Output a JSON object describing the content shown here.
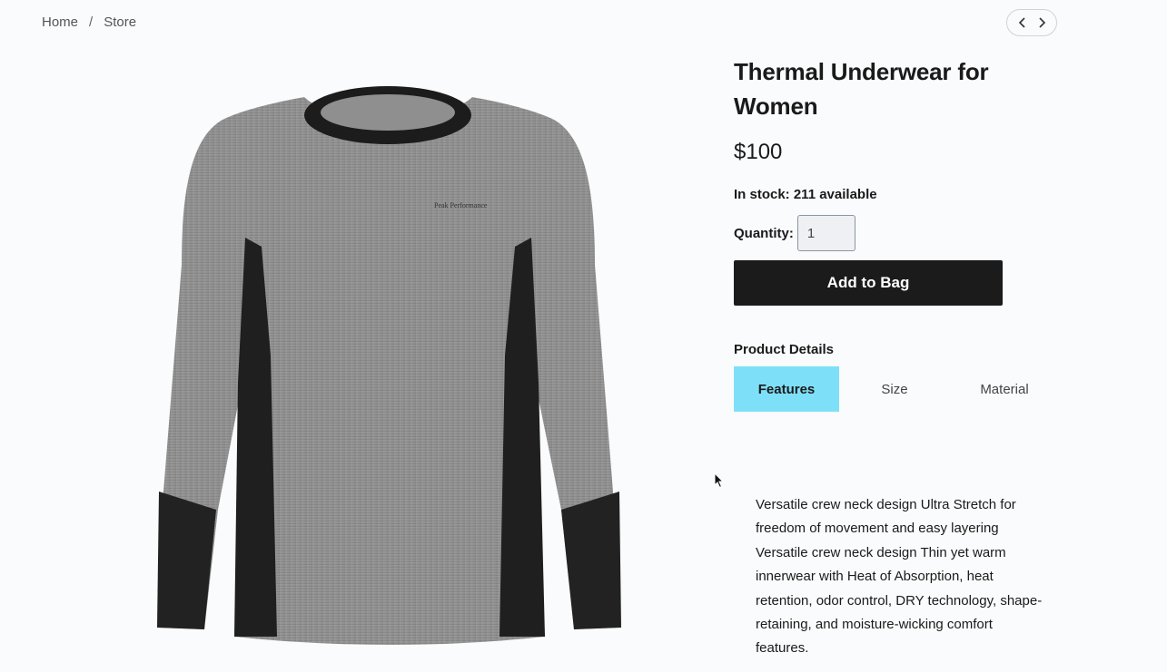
{
  "breadcrumb": {
    "items": [
      "Home",
      "Store"
    ],
    "separator": "/"
  },
  "pager": {
    "prev_icon": "chevron-left-icon",
    "next_icon": "chevron-right-icon"
  },
  "product": {
    "title": "Thermal Underwear for Women",
    "price": "$100",
    "stock_text": "In stock: 211 available",
    "quantity_label": "Quantity:",
    "quantity_value": "1",
    "add_to_bag_label": "Add to Bag",
    "details_heading": "Product Details",
    "tabs": [
      {
        "label": "Features",
        "active": true
      },
      {
        "label": "Size",
        "active": false
      },
      {
        "label": "Material",
        "active": false
      }
    ],
    "description": "Versatile crew neck design Ultra Stretch for freedom of movement and easy layering Versatile crew neck design Thin yet warm innerwear with Heat of Absorption, heat retention, odor control, DRY technology, shape-retaining, and moisture-wicking comfort features.",
    "image_brand_text": "Peak Performance"
  },
  "colors": {
    "active_tab": "#7ee0f8",
    "button_bg": "#1b1b1b",
    "page_bg": "#fafbfc"
  }
}
